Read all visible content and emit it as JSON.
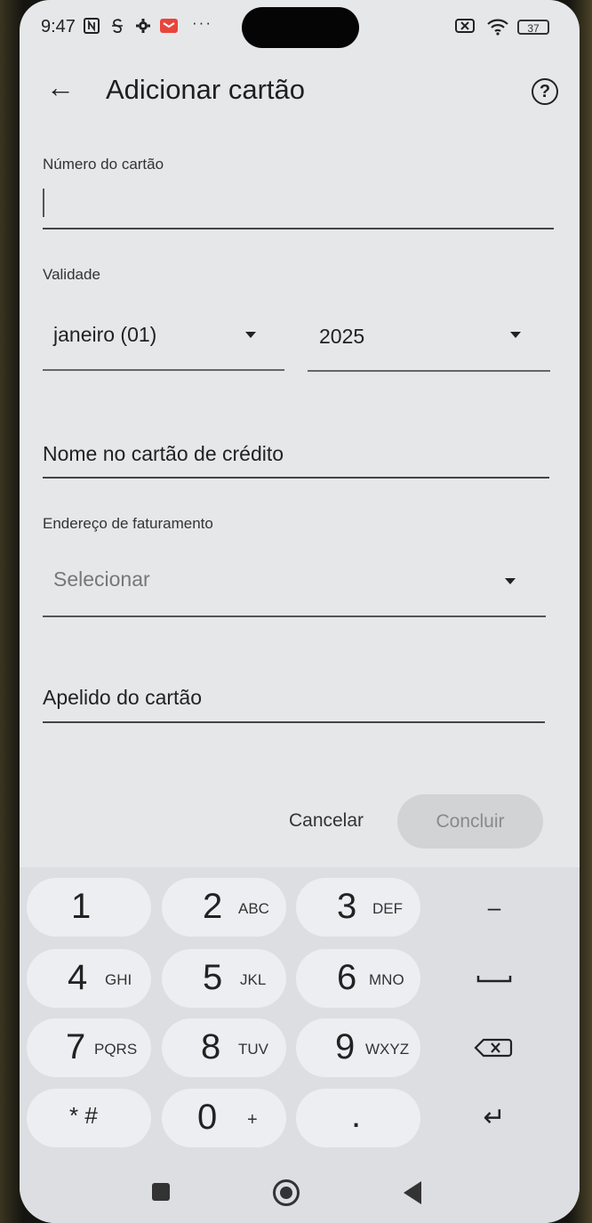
{
  "status_bar": {
    "time": "9:47",
    "left_icons": [
      "nfc-icon",
      "s-icon",
      "settings-icon",
      "mail-icon",
      "more-icon"
    ],
    "right_icons": [
      "sim-off-icon",
      "wifi-icon",
      "battery-icon"
    ],
    "battery": "37"
  },
  "app_bar": {
    "back_glyph": "←",
    "title": "Adicionar cartão",
    "help_glyph": "?"
  },
  "form": {
    "card_number_label": "Número do cartão",
    "card_number_value": "",
    "expiry_label": "Validade",
    "month_value": "janeiro (01)",
    "year_value": "2025",
    "name_label": "Nome no cartão de crédito",
    "billing_label": "Endereço de faturamento",
    "billing_placeholder": "Selecionar",
    "nickname_label": "Apelido do cartão"
  },
  "actions": {
    "cancel": "Cancelar",
    "done": "Concluir"
  },
  "keyboard": {
    "rows": [
      [
        {
          "n": "1",
          "s": ""
        },
        {
          "n": "2",
          "s": "ABC"
        },
        {
          "n": "3",
          "s": "DEF"
        }
      ],
      [
        {
          "n": "4",
          "s": "GHI"
        },
        {
          "n": "5",
          "s": "JKL"
        },
        {
          "n": "6",
          "s": "MNO"
        }
      ],
      [
        {
          "n": "7",
          "s": "PQRS"
        },
        {
          "n": "8",
          "s": "TUV"
        },
        {
          "n": "9",
          "s": "WXYZ"
        }
      ],
      [
        {
          "n": "* #",
          "s": ""
        },
        {
          "n": "0",
          "s": "+"
        },
        {
          "n": ".",
          "s": ""
        }
      ]
    ],
    "function_keys": [
      "–",
      "␣",
      "⌫",
      "↵"
    ]
  },
  "colors": {
    "screen_bg": "#e6e7e9",
    "keyboard_bg": "#dcdee2",
    "key_bg": "#eceef1",
    "done_button_bg": "#d2d3d5"
  }
}
